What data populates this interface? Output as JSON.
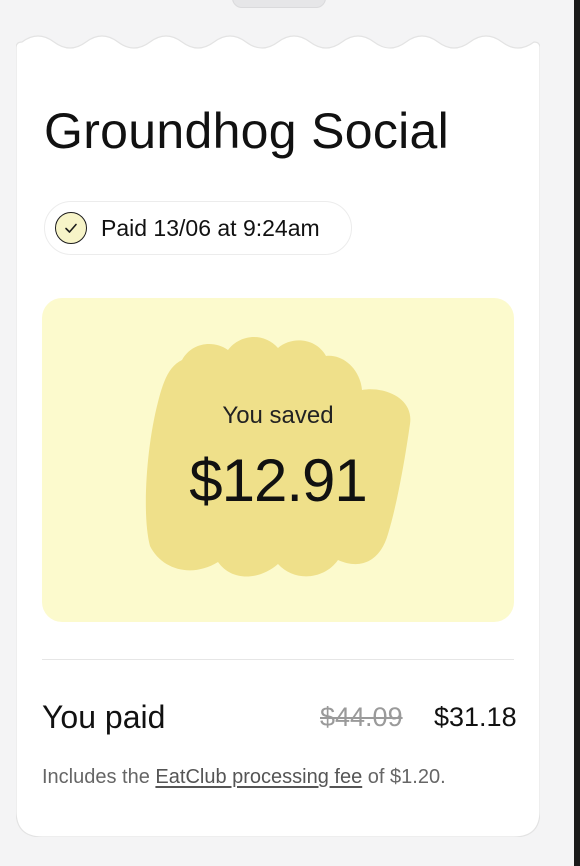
{
  "receipt": {
    "venue_name": "Groundhog Social",
    "payment_status": "Paid 13/06 at 9:24am",
    "check_icon": "check-icon",
    "savings": {
      "label": "You saved",
      "amount": "$12.91",
      "panel_color": "#fcfacd",
      "blob_color": "#efe08a"
    },
    "summary": {
      "label": "You paid",
      "original_price": "$44.09",
      "final_price": "$31.18"
    },
    "fee_note": {
      "prefix": "Includes the",
      "link_text": "EatClub processing fee",
      "suffix": "of $1.20."
    }
  }
}
